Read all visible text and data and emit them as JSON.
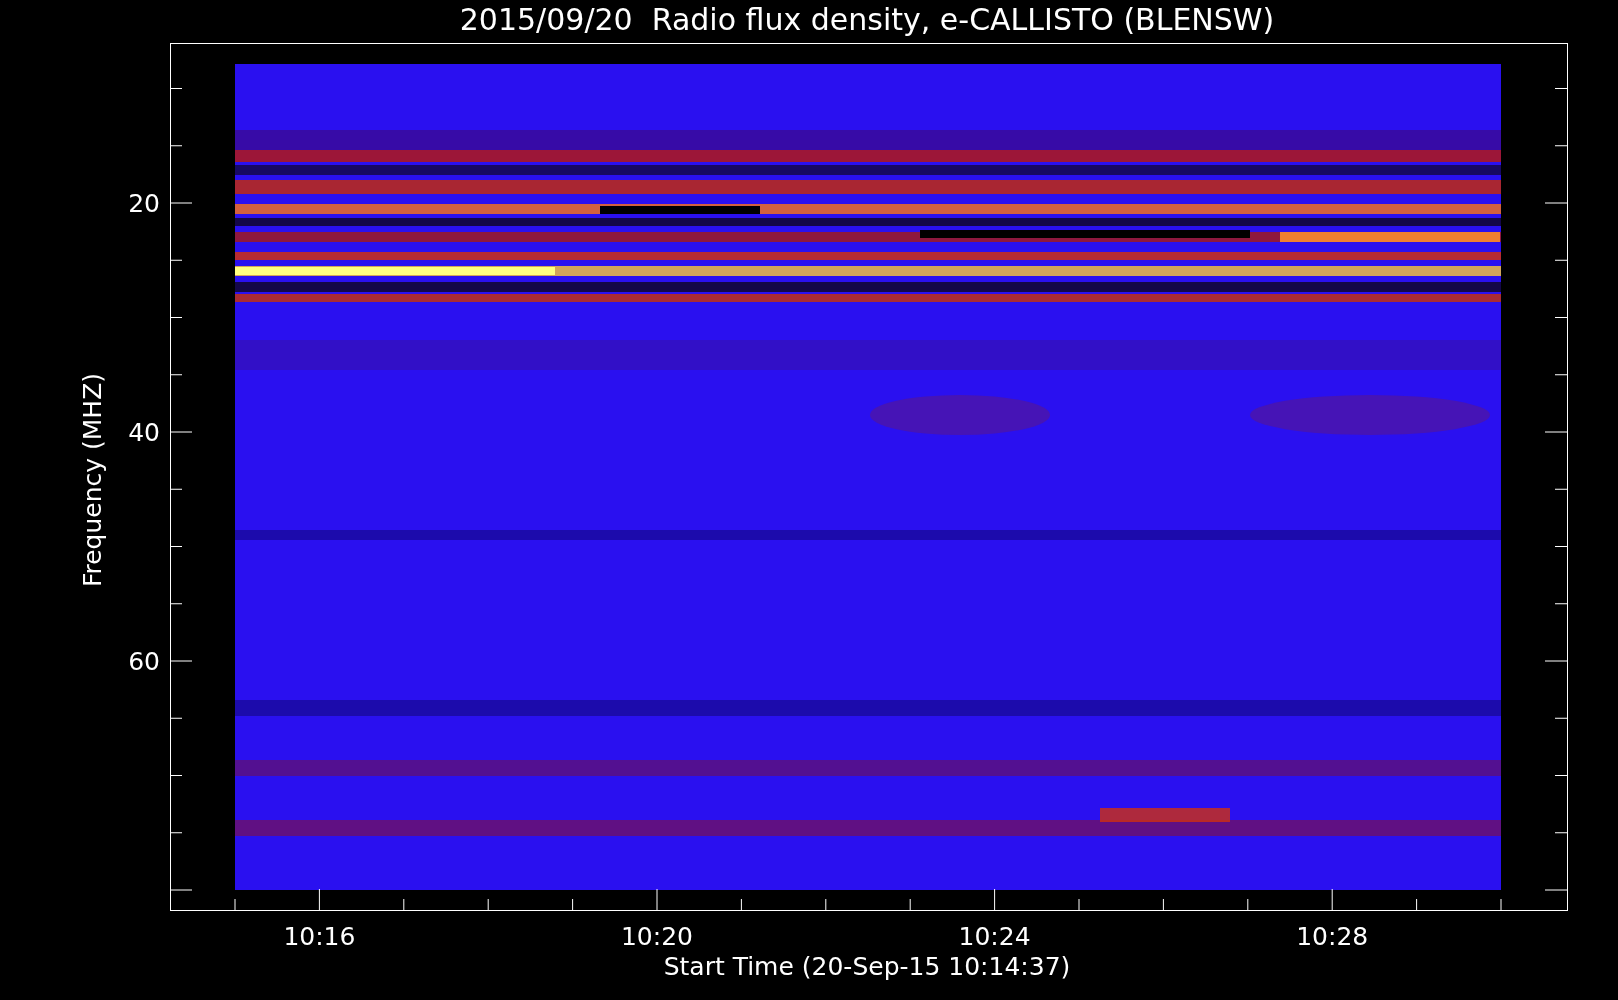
{
  "title": "2015/09/20  Radio flux density, e-CALLISTO (BLENSW)",
  "y_axis": {
    "label": "Frequency (MHZ)",
    "tick_labels": [
      "20",
      "40",
      "60"
    ]
  },
  "x_axis": {
    "label": "Start Time (20-Sep-15 10:14:37)",
    "tick_labels": [
      "10:16",
      "10:20",
      "10:24",
      "10:28"
    ]
  }
}
